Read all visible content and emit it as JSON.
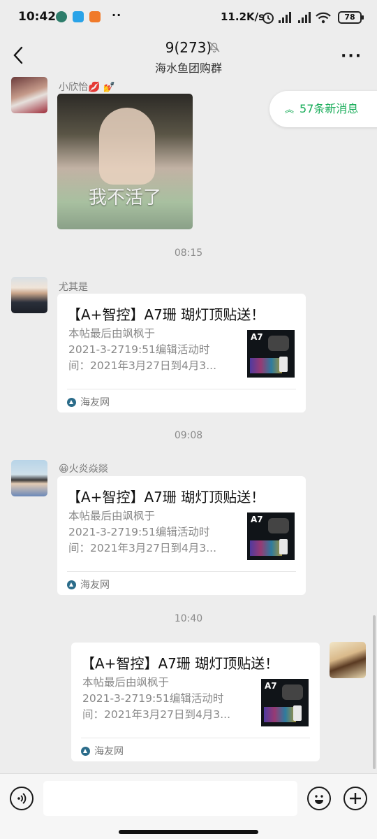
{
  "status_bar": {
    "time": "10:42",
    "dots": "··",
    "net_speed": "11.2K/s",
    "battery": "78"
  },
  "header": {
    "title": "9(273)",
    "subtitle": "海水鱼团购群",
    "more_label": "···"
  },
  "new_messages": {
    "label": "57条新消息"
  },
  "messages": [
    {
      "sender": "小欣怡💋 💅",
      "type": "image",
      "image_caption": "我不活了"
    },
    {
      "timestamp": "08:15"
    },
    {
      "sender": "尤其是",
      "type": "link",
      "title": "【A+智控】A7珊 瑚灯顶贴送！",
      "desc_lines": [
        "本帖最后由飒枫于",
        "2021-3-2719:51编辑活动时",
        "间：2021年3月27日到4月3..."
      ],
      "thumb_text": "A7",
      "source": "海友网"
    },
    {
      "timestamp": "09:08"
    },
    {
      "sender": "😀火炎焱燚",
      "type": "link",
      "title": "【A+智控】A7珊 瑚灯顶贴送！",
      "desc_lines": [
        "本帖最后由飒枫于",
        "2021-3-2719:51编辑活动时",
        "间：2021年3月27日到4月3..."
      ],
      "thumb_text": "A7",
      "source": "海友网"
    },
    {
      "timestamp": "10:40"
    },
    {
      "sender": "",
      "type": "link",
      "title": "【A+智控】A7珊 瑚灯顶贴送！",
      "desc_lines": [
        "本帖最后由飒枫于",
        "2021-3-2719:51编辑活动时",
        "间：2021年3月27日到4月3..."
      ],
      "thumb_text": "A7",
      "source": "海友网"
    }
  ],
  "input_bar": {
    "placeholder": ""
  },
  "colors": {
    "accent": "#1aad5a",
    "background": "#ededed"
  }
}
